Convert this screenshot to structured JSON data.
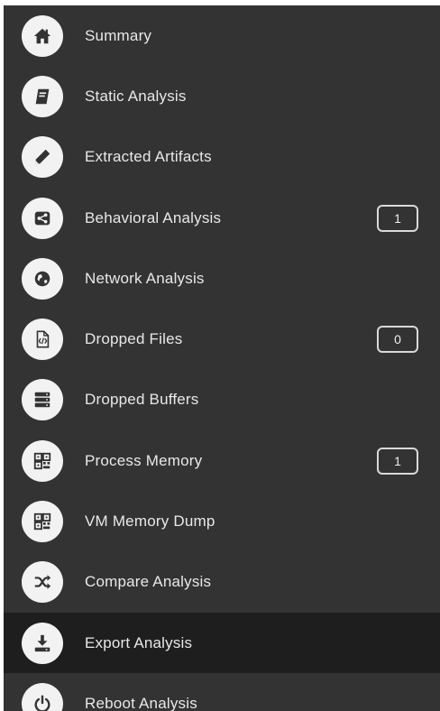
{
  "menu": {
    "items": [
      {
        "label": "Summary",
        "icon": "home-icon"
      },
      {
        "label": "Static Analysis",
        "icon": "book-icon"
      },
      {
        "label": "Extracted Artifacts",
        "icon": "pencil-icon"
      },
      {
        "label": "Behavioral Analysis",
        "icon": "share-icon",
        "badge": "1"
      },
      {
        "label": "Network Analysis",
        "icon": "globe-icon"
      },
      {
        "label": "Dropped Files",
        "icon": "code-file-icon",
        "badge": "0"
      },
      {
        "label": "Dropped Buffers",
        "icon": "server-icon"
      },
      {
        "label": "Process Memory",
        "icon": "qr-code-icon",
        "badge": "1"
      },
      {
        "label": "VM Memory Dump",
        "icon": "qr-code-icon"
      },
      {
        "label": "Compare Analysis",
        "icon": "shuffle-icon"
      },
      {
        "label": "Export Analysis",
        "icon": "download-icon",
        "active": true
      },
      {
        "label": "Reboot Analysis",
        "icon": "power-icon"
      }
    ]
  },
  "colors": {
    "background": "#333333",
    "active_background": "#1e1e1e",
    "icon_circle": "#f2f2f2",
    "icon_glyph": "#333333",
    "text": "#e8e8e8"
  }
}
